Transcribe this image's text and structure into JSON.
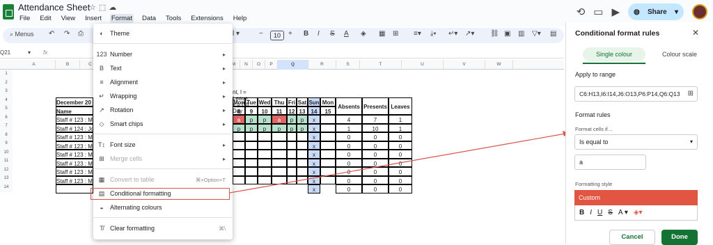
{
  "app": {
    "title": "Attendance Sheet",
    "share_label": "Share",
    "menus": [
      "File",
      "Edit",
      "View",
      "Insert",
      "Format",
      "Data",
      "Tools",
      "Extensions",
      "Help"
    ],
    "active_menu": "Format"
  },
  "toolbar": {
    "search": "Menus",
    "font_size": "10"
  },
  "formula": {
    "cell_ref": "Q21",
    "fx": "fx"
  },
  "sheet": {
    "columns": [
      "A",
      "B",
      "C",
      "D",
      "E",
      "F",
      "G",
      "H",
      "I",
      "J",
      "K",
      "L",
      "M",
      "N",
      "O",
      "P",
      "Q",
      "R",
      "S",
      "T",
      "U",
      "V",
      "W"
    ],
    "rows": [
      "1",
      "2",
      "3",
      "4",
      "5",
      "6",
      "7",
      "8",
      "9",
      "10",
      "11",
      "12",
      "13",
      "14"
    ],
    "legend_text": "nt, l = Leave, x = Off Day",
    "month_header": "December 20",
    "name_header": "Name",
    "day_names": [
      "Mon",
      "Tue",
      "Wed",
      "Thu",
      "Fri",
      "Sat",
      "Sun",
      "Mon"
    ],
    "day_numbers": [
      "8",
      "9",
      "10",
      "11",
      "12",
      "13",
      "14",
      "15"
    ],
    "summary_headers": [
      "Absents",
      "Presents",
      "Leaves"
    ],
    "staff": [
      "Staff # 123 : M",
      "Staff # 124 : Jo",
      "Staff # 123 : M",
      "Staff # 123 : M",
      "Staff # 123 : M",
      "Staff # 123 : M",
      "Staff # 123 : M",
      "Staff # 123 : M"
    ],
    "attendance_row1": [
      "a",
      "p",
      "p",
      "a",
      "p",
      "p",
      "x"
    ],
    "attendance_row2": [
      "p",
      "p",
      "p",
      "p",
      "p",
      "p",
      "x"
    ],
    "off_marker": "x",
    "totals": [
      [
        "4",
        "7",
        "1"
      ],
      [
        "1",
        "10",
        "1"
      ],
      [
        "0",
        "0",
        "0"
      ],
      [
        "0",
        "0",
        "0"
      ],
      [
        "0",
        "0",
        "0"
      ],
      [
        "0",
        "0",
        "0"
      ],
      [
        "0",
        "0",
        "0"
      ],
      [
        "0",
        "0",
        "0"
      ],
      [
        "0",
        "0",
        "0"
      ]
    ]
  },
  "format_menu": {
    "items": [
      {
        "label": "Theme",
        "icon": "palette-icon",
        "arrow": false
      },
      {
        "label": "Number",
        "icon": "123-icon",
        "arrow": true
      },
      {
        "label": "Text",
        "icon": "bold-icon",
        "arrow": true
      },
      {
        "label": "Alignment",
        "icon": "align-icon",
        "arrow": true
      },
      {
        "label": "Wrapping",
        "icon": "wrap-icon",
        "arrow": true
      },
      {
        "label": "Rotation",
        "icon": "rotate-icon",
        "arrow": true
      },
      {
        "label": "Smart chips",
        "icon": "chip-icon",
        "arrow": true
      },
      {
        "label": "Font size",
        "icon": "font-size-icon",
        "arrow": true
      },
      {
        "label": "Merge cells",
        "icon": "merge-icon",
        "arrow": true,
        "disabled": true
      },
      {
        "label": "Convert to table",
        "icon": "table-icon",
        "shortcut": "⌘+Option+T",
        "disabled": true
      },
      {
        "label": "Conditional formatting",
        "icon": "conditional-icon"
      },
      {
        "label": "Alternating colours",
        "icon": "fill-icon"
      },
      {
        "label": "Clear formatting",
        "icon": "clear-format-icon",
        "shortcut": "⌘\\"
      }
    ]
  },
  "panel": {
    "title": "Conditional format rules",
    "tab_single": "Single colour",
    "tab_scale": "Colour scale",
    "apply_label": "Apply to range",
    "range": "C6:H13,I6:I14,J6:O13,P6:P14,Q6:Q13",
    "rules_label": "Format rules",
    "if_label": "Format cells if…",
    "condition": "Is equal to",
    "value": "a",
    "style_label": "Formatting style",
    "style_name": "Custom",
    "cancel": "Cancel",
    "done": "Done",
    "colors": {
      "accent": "#137333",
      "custom_fill": "#e25542",
      "highlight": "#d9534f"
    }
  }
}
